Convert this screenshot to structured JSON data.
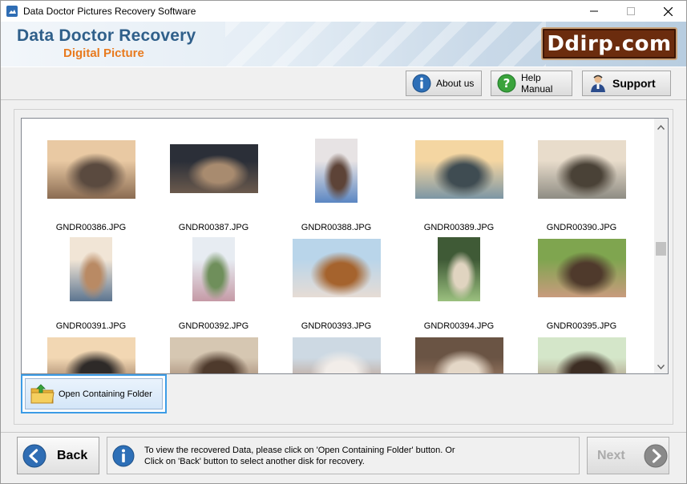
{
  "window": {
    "title": "Data Doctor Pictures Recovery Software",
    "controls": [
      "minimize",
      "maximize",
      "close"
    ]
  },
  "banner": {
    "title": "Data Doctor Recovery",
    "subtitle": "Digital Picture",
    "logo_text": "Ddirp.com"
  },
  "toolbar": {
    "about_label": "About us",
    "help_label": "Help Manual",
    "support_label": "Support"
  },
  "gallery": {
    "items": [
      {
        "name": "GNDR00386.JPG",
        "palette": [
          "#e9c9a3",
          "#8a6b52",
          "#5a4a3f"
        ]
      },
      {
        "name": "GNDR00387.JPG",
        "palette": [
          "#2b2f38",
          "#6b5a4d",
          "#a88b6f"
        ]
      },
      {
        "name": "GNDR00388.JPG",
        "palette": [
          "#e7e3e4",
          "#5b86c2",
          "#5d4337"
        ]
      },
      {
        "name": "GNDR00389.JPG",
        "palette": [
          "#f4d6a2",
          "#7c96a4",
          "#3f4c52"
        ]
      },
      {
        "name": "GNDR00390.JPG",
        "palette": [
          "#e8dccb",
          "#8e8c83",
          "#4a4237"
        ]
      },
      {
        "name": "GNDR00391.JPG",
        "palette": [
          "#f1e5d6",
          "#5c7590",
          "#b98a64"
        ]
      },
      {
        "name": "GNDR00392.JPG",
        "palette": [
          "#e7ecf2",
          "#c59aa6",
          "#6f8f5b"
        ]
      },
      {
        "name": "GNDR00393.JPG",
        "palette": [
          "#b9d5ea",
          "#e6dcd5",
          "#a5632d"
        ]
      },
      {
        "name": "GNDR00394.JPG",
        "palette": [
          "#3f5a36",
          "#9bc07f",
          "#e0d4c0"
        ]
      },
      {
        "name": "GNDR00395.JPG",
        "palette": [
          "#7fa54f",
          "#c89b7d",
          "#4f3a2c"
        ]
      },
      {
        "name": "",
        "palette": [
          "#f2d7b3",
          "#7b5a45",
          "#2e2a28"
        ]
      },
      {
        "name": "",
        "palette": [
          "#d6c7b2",
          "#8e6e58",
          "#4e3a2c"
        ]
      },
      {
        "name": "",
        "palette": [
          "#cdd9e3",
          "#b88a6e",
          "#f2ede9"
        ]
      },
      {
        "name": "",
        "palette": [
          "#6a5444",
          "#b58e74",
          "#e4d7c7"
        ]
      },
      {
        "name": "",
        "palette": [
          "#d4e6c9",
          "#9b7764",
          "#3c2d23"
        ]
      }
    ]
  },
  "actions": {
    "open_folder_label": "Open Containing Folder"
  },
  "footer": {
    "back_label": "Back",
    "next_label": "Next",
    "info_line1": "To view the recovered Data, please click on 'Open Containing Folder' button. Or",
    "info_line2": "Click on 'Back' button to select another disk for recovery."
  },
  "colors": {
    "brand_blue": "#2f5f8a",
    "brand_orange": "#e87a1e",
    "logo_bg": "#6b2c0e",
    "selection_blue": "#3c9ce6"
  },
  "icons": {
    "about": "info-icon",
    "help": "question-icon",
    "support": "support-person-icon",
    "folder": "folder-open-icon",
    "back": "arrow-left-circle-icon",
    "next": "arrow-right-circle-icon",
    "info": "info-icon"
  }
}
